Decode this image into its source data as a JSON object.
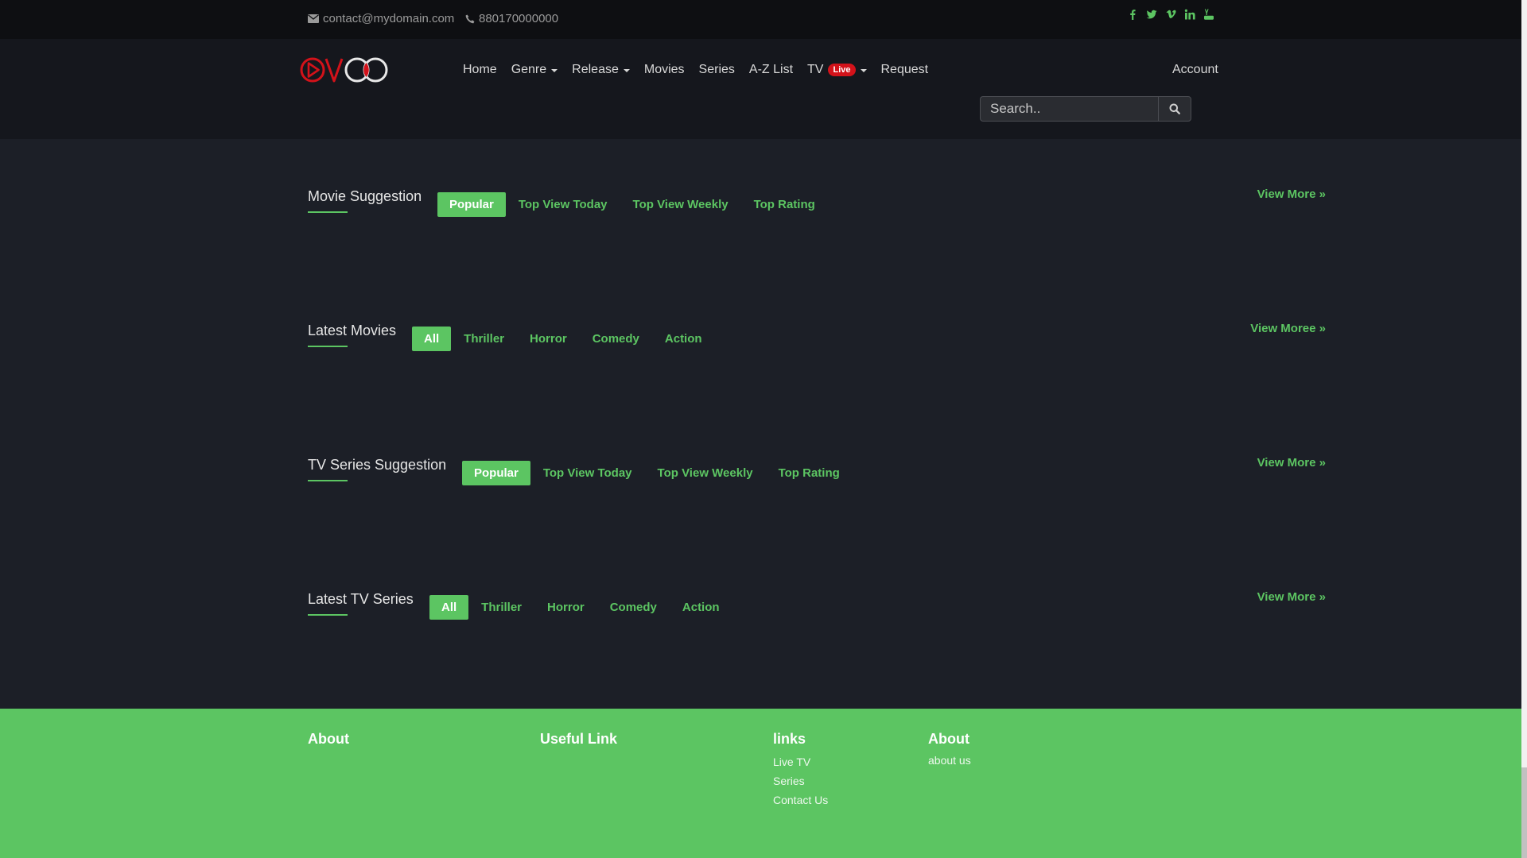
{
  "topbar": {
    "email": "contact@mydomain.com",
    "phone": "880170000000",
    "social_icons": [
      "facebook-icon",
      "twitter-icon",
      "vimeo-icon",
      "linkedin-icon",
      "youtube-icon"
    ]
  },
  "header": {
    "nav": {
      "home": "Home",
      "genre": "Genre",
      "release": "Release",
      "movies": "Movies",
      "series": "Series",
      "az": "A-Z List",
      "tv": "TV",
      "live_badge": "Live",
      "request": "Request"
    },
    "account": "Account",
    "search_placeholder": "Search.."
  },
  "sections": {
    "movie_suggestion": {
      "title": "Movie Suggestion",
      "filters": [
        "Popular",
        "Top View Today",
        "Top View Weekly",
        "Top Rating"
      ],
      "view_more": "View More »"
    },
    "latest_movies": {
      "title": "Latest Movies",
      "filters": [
        "All",
        "Thriller",
        "Horror",
        "Comedy",
        "Action"
      ],
      "view_more": "View Moree »"
    },
    "tv_series_suggestion": {
      "title": "TV Series Suggestion",
      "filters": [
        "Popular",
        "Top View Today",
        "Top View Weekly",
        "Top Rating"
      ],
      "view_more": "View More »"
    },
    "latest_tv_series": {
      "title": "Latest TV Series",
      "filters": [
        "All",
        "Thriller",
        "Horror",
        "Comedy",
        "Action"
      ],
      "view_more": "View More »"
    }
  },
  "footer": {
    "about_heading": "About",
    "useful_link_heading": "Useful Link",
    "links_heading": "links",
    "links": [
      "Live TV",
      "Series",
      "Contact Us"
    ],
    "about2_heading": "About",
    "about_us": "about us"
  },
  "colors": {
    "accent": "#5cc562",
    "live_badge": "#d3121a",
    "background": "#1c1f27"
  }
}
